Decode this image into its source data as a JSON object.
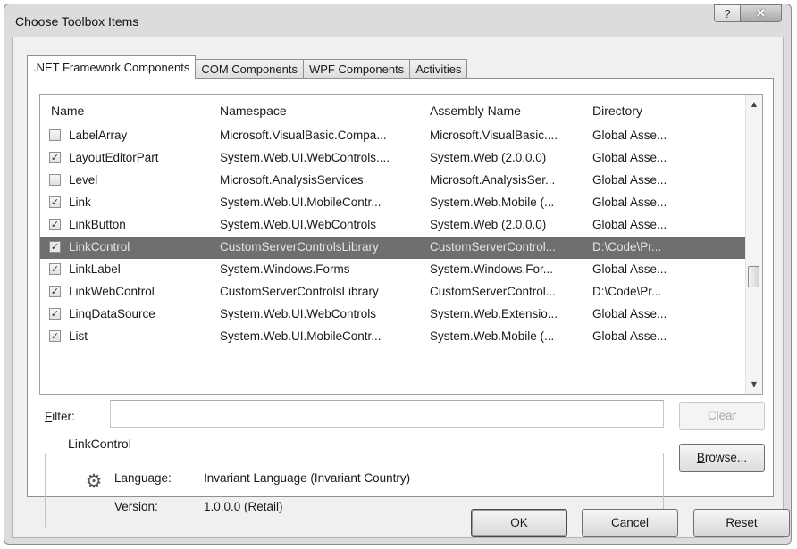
{
  "window": {
    "title": "Choose Toolbox Items",
    "help_label": "?",
    "close_label": "✕"
  },
  "tabs": [
    {
      "label": ".NET Framework Components",
      "active": true
    },
    {
      "label": "COM Components",
      "active": false
    },
    {
      "label": "WPF Components",
      "active": false
    },
    {
      "label": "Activities",
      "active": false
    }
  ],
  "list": {
    "columns": {
      "name": "Name",
      "namespace": "Namespace",
      "assembly": "Assembly Name",
      "directory": "Directory"
    },
    "rows": [
      {
        "checked": false,
        "name": "LabelArray",
        "namespace": "Microsoft.VisualBasic.Compa...",
        "assembly": "Microsoft.VisualBasic....",
        "directory": "Global Asse..."
      },
      {
        "checked": true,
        "name": "LayoutEditorPart",
        "namespace": "System.Web.UI.WebControls....",
        "assembly": "System.Web (2.0.0.0)",
        "directory": "Global Asse..."
      },
      {
        "checked": false,
        "name": "Level",
        "namespace": "Microsoft.AnalysisServices",
        "assembly": "Microsoft.AnalysisSer...",
        "directory": "Global Asse..."
      },
      {
        "checked": true,
        "name": "Link",
        "namespace": "System.Web.UI.MobileContr...",
        "assembly": "System.Web.Mobile (...",
        "directory": "Global Asse..."
      },
      {
        "checked": true,
        "name": "LinkButton",
        "namespace": "System.Web.UI.WebControls",
        "assembly": "System.Web (2.0.0.0)",
        "directory": "Global Asse..."
      },
      {
        "checked": true,
        "name": "LinkControl",
        "namespace": "CustomServerControlsLibrary",
        "assembly": "CustomServerControl...",
        "directory": "D:\\Code\\Pr...",
        "selected": true
      },
      {
        "checked": true,
        "name": "LinkLabel",
        "namespace": "System.Windows.Forms",
        "assembly": "System.Windows.For...",
        "directory": "Global Asse..."
      },
      {
        "checked": true,
        "name": "LinkWebControl",
        "namespace": "CustomServerControlsLibrary",
        "assembly": "CustomServerControl...",
        "directory": "D:\\Code\\Pr..."
      },
      {
        "checked": true,
        "name": "LinqDataSource",
        "namespace": "System.Web.UI.WebControls",
        "assembly": "System.Web.Extensio...",
        "directory": "Global Asse..."
      },
      {
        "checked": true,
        "name": "List",
        "namespace": "System.Web.UI.MobileContr...",
        "assembly": "System.Web.Mobile (...",
        "directory": "Global Asse..."
      }
    ]
  },
  "filter": {
    "label": "Filter:",
    "value": ""
  },
  "buttons": {
    "clear": "Clear",
    "browse": "Browse...",
    "ok": "OK",
    "cancel": "Cancel",
    "reset": "Reset"
  },
  "details": {
    "title": "LinkControl",
    "language_label": "Language:",
    "language_value": "Invariant Language (Invariant Country)",
    "version_label": "Version:",
    "version_value": "1.0.0.0 (Retail)"
  }
}
